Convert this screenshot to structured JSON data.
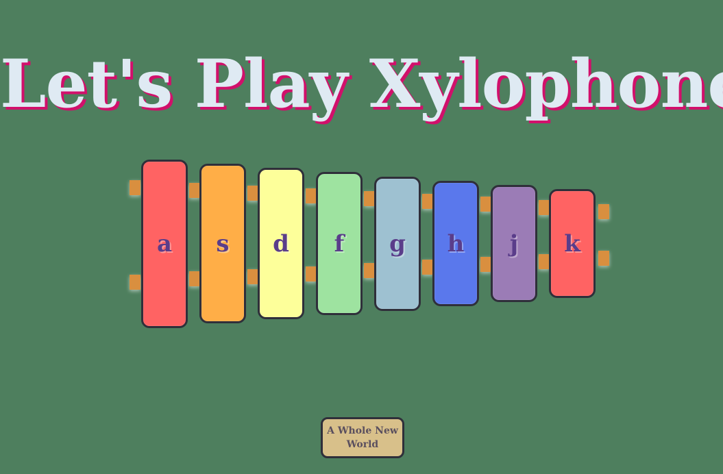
{
  "title": "Let's Play Xylophone",
  "keys": [
    {
      "label": "a",
      "color": "#ff6363"
    },
    {
      "label": "s",
      "color": "#ffae47"
    },
    {
      "label": "d",
      "color": "#fdff9a"
    },
    {
      "label": "f",
      "color": "#9ee3a0"
    },
    {
      "label": "g",
      "color": "#9ec1d1"
    },
    {
      "label": "h",
      "color": "#5a78ec"
    },
    {
      "label": "j",
      "color": "#9b7cb6"
    },
    {
      "label": "k",
      "color": "#ff6363"
    }
  ],
  "song_button": {
    "label": "A Whole New World"
  },
  "colors": {
    "background": "#4e7f5e",
    "title_text": "#dfeaf3",
    "title_shadow": "#d1106b",
    "peg": "#d98f3f",
    "key_text": "#5a3d8a",
    "button_bg": "#d8c08a"
  }
}
